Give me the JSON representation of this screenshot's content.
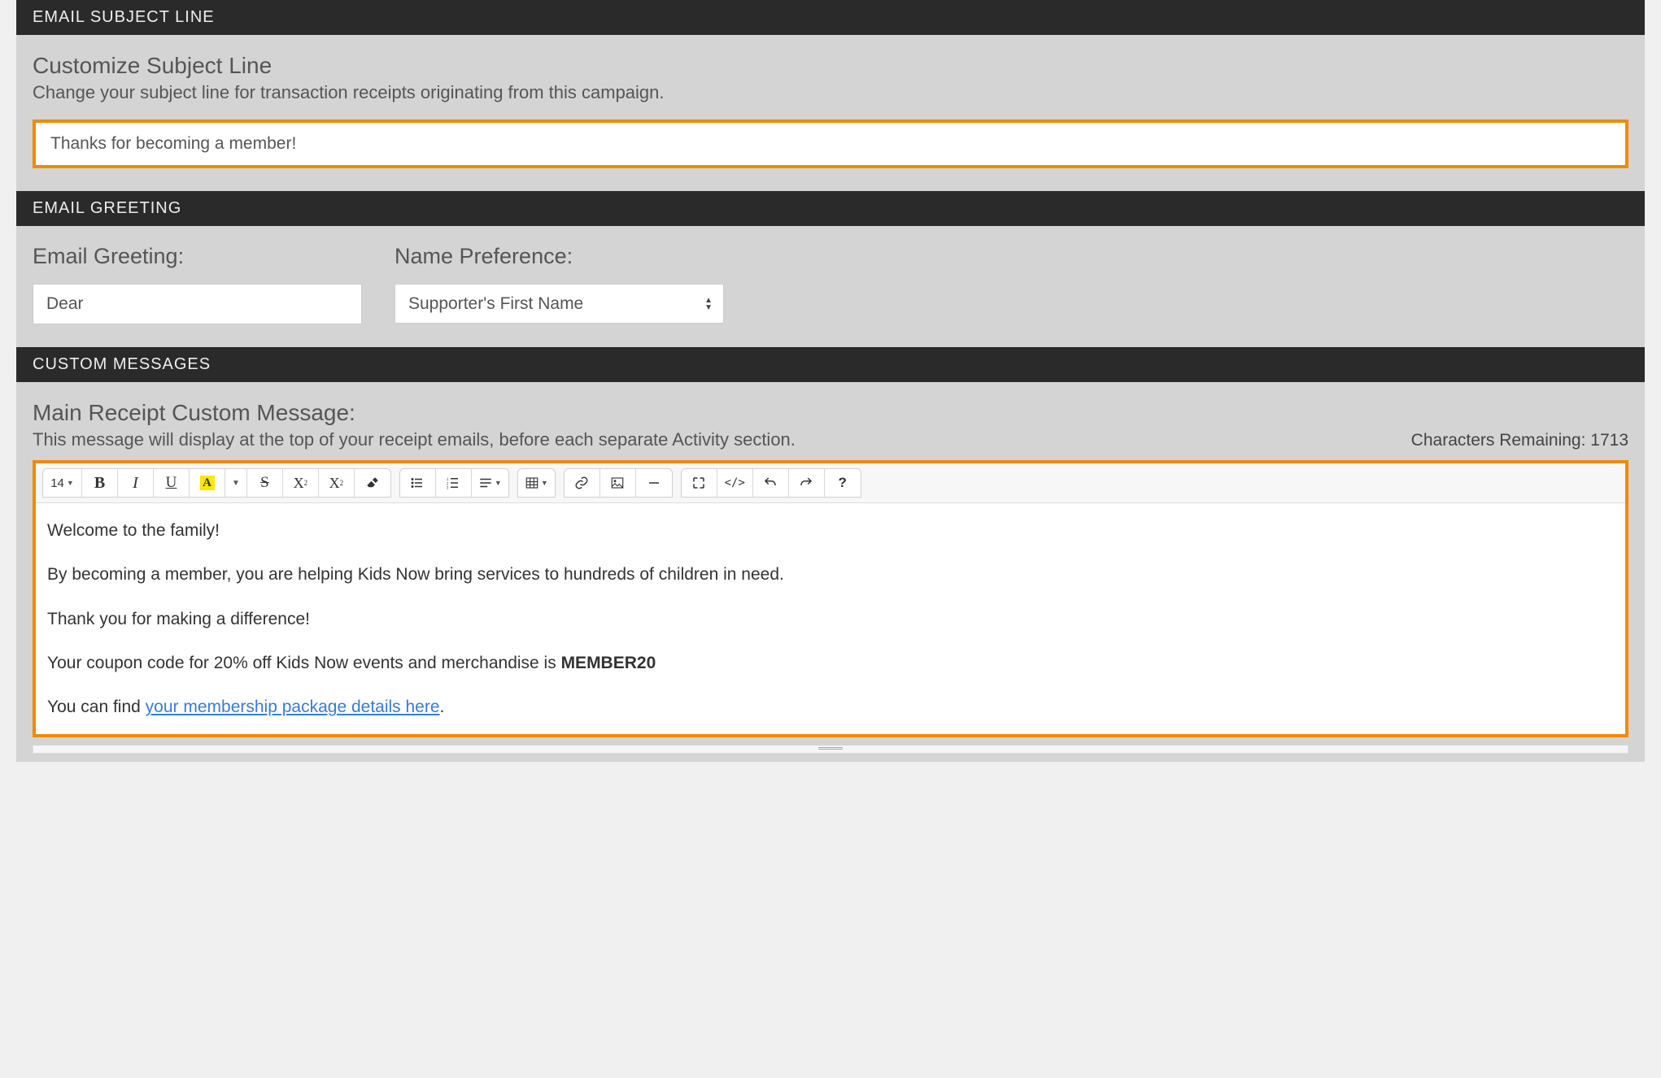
{
  "sections": {
    "emailSubject": {
      "header": "EMAIL SUBJECT LINE",
      "title": "Customize Subject Line",
      "desc": "Change your subject line for transaction receipts originating from this campaign.",
      "value": "Thanks for becoming a member!"
    },
    "emailGreeting": {
      "header": "EMAIL GREETING",
      "greetingLabel": "Email Greeting:",
      "greetingValue": "Dear",
      "namePrefLabel": "Name Preference:",
      "namePrefValue": "Supporter's First Name"
    },
    "customMessages": {
      "header": "CUSTOM MESSAGES",
      "title": "Main Receipt Custom Message:",
      "desc": "This message will display at the top of your receipt emails, before each separate Activity section.",
      "charsRemainingLabel": "Characters Remaining:",
      "charsRemaining": "1713"
    }
  },
  "toolbar": {
    "fontSize": "14",
    "bold": "B",
    "italic": "I",
    "underline": "U",
    "fontColor": "A",
    "strike": "S",
    "sup": "X",
    "sub": "X",
    "help": "?",
    "code": "</>"
  },
  "editor": {
    "p1": "Welcome to the family!",
    "p2": "By becoming a member, you are helping Kids Now bring services to hundreds of children in need.",
    "p3": "Thank you for making a difference!",
    "p4_pre": "Your coupon code for 20% off Kids Now events and merchandise is ",
    "p4_bold": "MEMBER20",
    "p5_pre": "You can find ",
    "p5_link": "your membership package details here",
    "p5_post": "."
  }
}
